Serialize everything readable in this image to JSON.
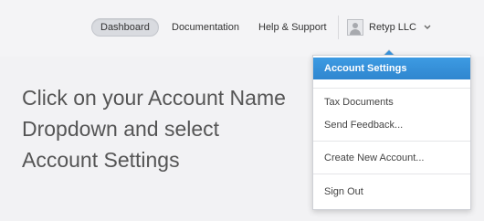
{
  "nav": {
    "dashboard": "Dashboard",
    "documentation": "Documentation",
    "help_support": "Help & Support",
    "account_name": "Retyp LLC"
  },
  "hero": {
    "instruction": "Click on your Account Name Dropdown and select Account Settings"
  },
  "dropdown": {
    "account_settings": "Account Settings",
    "tax_documents": "Tax Documents",
    "send_feedback": "Send Feedback...",
    "create_new_account": "Create New Account...",
    "sign_out": "Sign Out"
  },
  "colors": {
    "accent": "#3a95de",
    "background": "#f2f2f4"
  }
}
